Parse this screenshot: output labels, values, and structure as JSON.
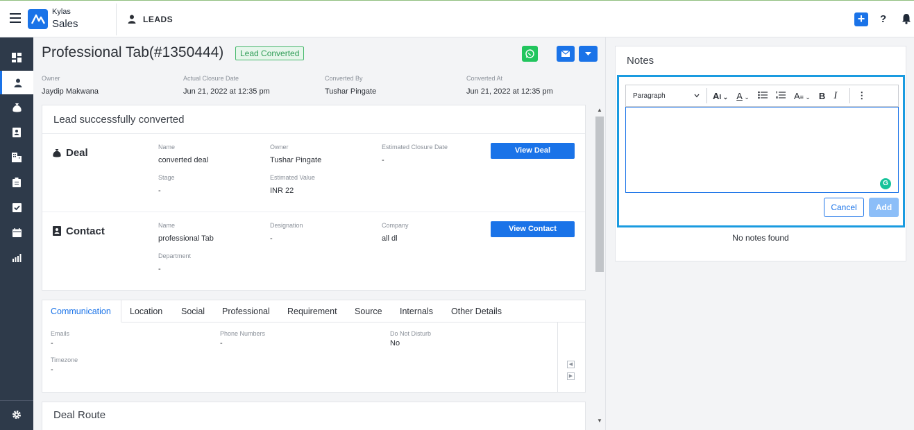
{
  "header": {
    "brand_top": "Kylas",
    "brand_bottom": "Sales",
    "breadcrumb": "LEADS",
    "help": "?"
  },
  "sidebar": {
    "items": [
      "dashboard",
      "leads",
      "deals",
      "contacts",
      "companies",
      "tasks-clipboard",
      "tasks",
      "calendar",
      "reports"
    ],
    "bottom": "settings"
  },
  "lead": {
    "title": "Professional Tab(#1350444)",
    "status_badge": "Lead Converted",
    "meta": [
      {
        "label": "Owner",
        "value": "Jaydip Makwana"
      },
      {
        "label": "Actual Closure Date",
        "value": "Jun 21, 2022 at 12:35 pm"
      },
      {
        "label": "Converted By",
        "value": "Tushar Pingate"
      },
      {
        "label": "Converted At",
        "value": "Jun 21, 2022 at 12:35 pm"
      }
    ]
  },
  "conversion": {
    "heading": "Lead successfully converted",
    "deal": {
      "title": "Deal",
      "fields": [
        {
          "label": "Name",
          "value": "converted deal"
        },
        {
          "label": "Owner",
          "value": "Tushar Pingate"
        },
        {
          "label": "Estimated Closure Date",
          "value": "-"
        },
        {
          "label": "Stage",
          "value": "-"
        },
        {
          "label": "Estimated Value",
          "value": "INR 22"
        }
      ],
      "button": "View Deal"
    },
    "contact": {
      "title": "Contact",
      "fields": [
        {
          "label": "Name",
          "value": "professional Tab"
        },
        {
          "label": "Designation",
          "value": "-"
        },
        {
          "label": "Company",
          "value": "all dl"
        },
        {
          "label": "Department",
          "value": "-"
        }
      ],
      "button": "View Contact"
    }
  },
  "tabs": {
    "items": [
      "Communication",
      "Location",
      "Social",
      "Professional",
      "Requirement",
      "Source",
      "Internals",
      "Other Details"
    ],
    "active": "Communication",
    "fields": [
      {
        "label": "Emails",
        "value": "-"
      },
      {
        "label": "Phone Numbers",
        "value": "-"
      },
      {
        "label": "Do Not Disturb",
        "value": "No"
      },
      {
        "label": "Timezone",
        "value": "-"
      }
    ]
  },
  "deal_route": {
    "heading": "Deal Route"
  },
  "notes": {
    "title": "Notes",
    "paragraph_select": "Paragraph",
    "cancel": "Cancel",
    "add": "Add",
    "empty": "No notes found",
    "grammarly": "G"
  },
  "colors": {
    "primary": "#1a73e8",
    "sidebar": "#2e3a4a",
    "success": "#2e9c56",
    "whatsapp": "#22c55e",
    "focus_border": "#1a9be0"
  }
}
